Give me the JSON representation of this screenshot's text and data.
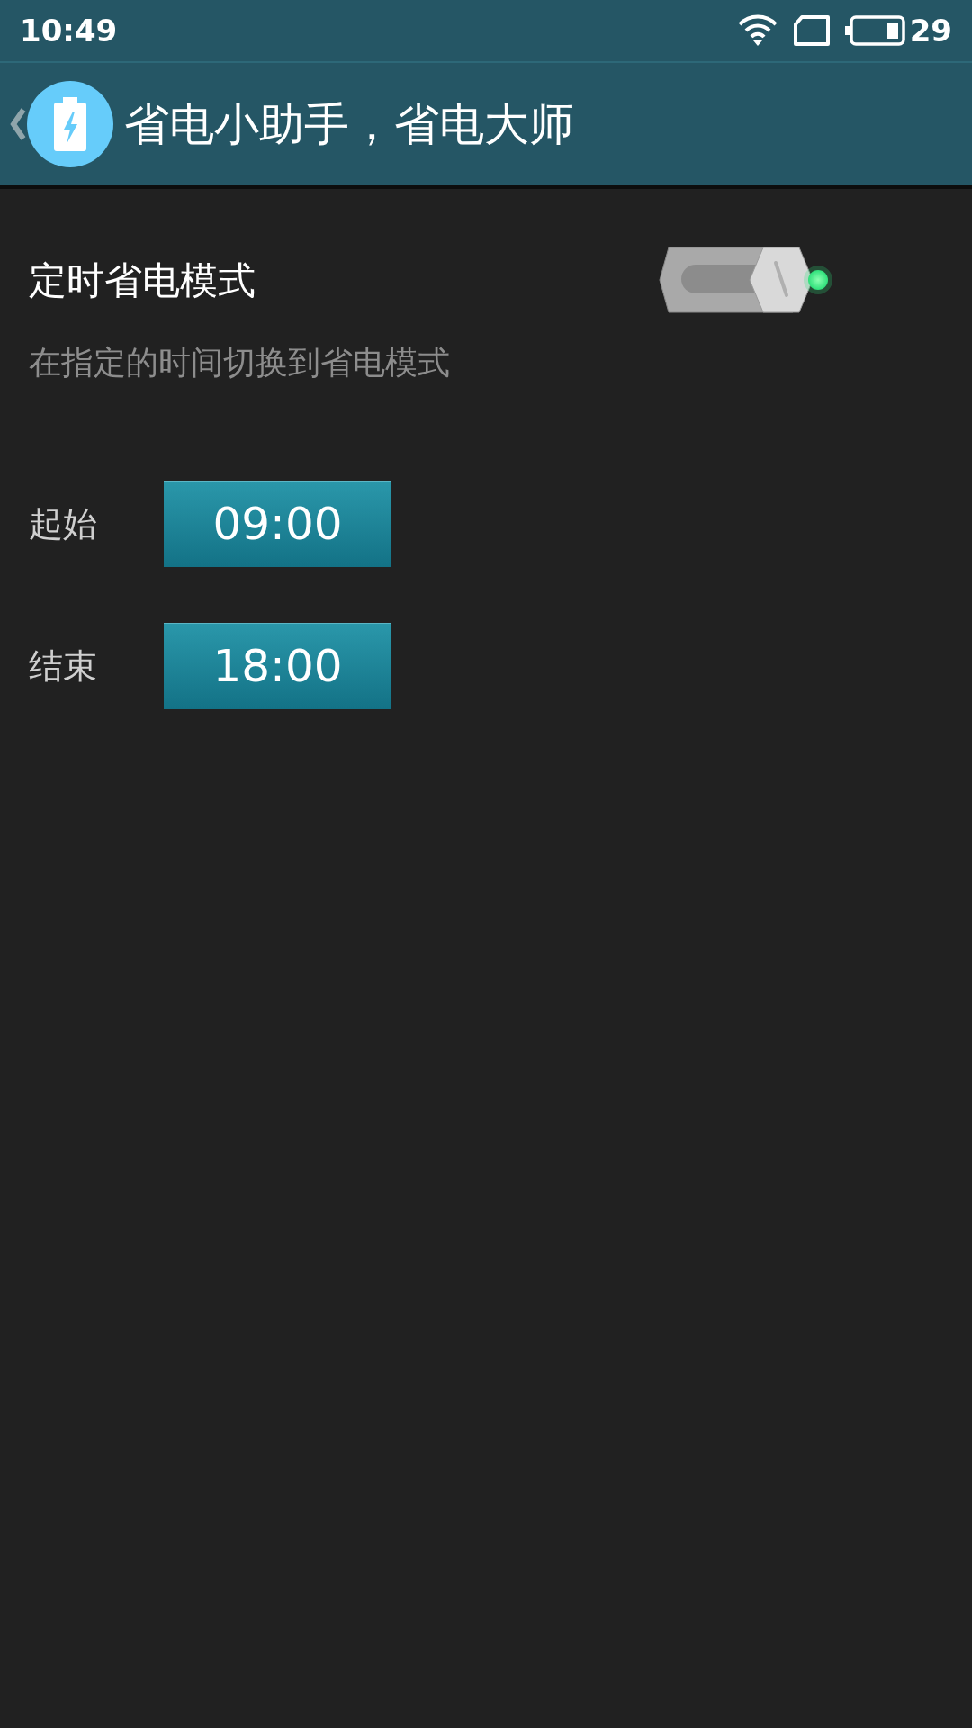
{
  "status_bar": {
    "time": "10:49",
    "battery": "29"
  },
  "header": {
    "title": "省电小助手，省电大师"
  },
  "setting": {
    "title": "定时省电模式",
    "description": "在指定的时间切换到省电模式",
    "on": true
  },
  "times": [
    {
      "label": "起始",
      "value": "09:00"
    },
    {
      "label": "结束",
      "value": "18:00"
    }
  ]
}
